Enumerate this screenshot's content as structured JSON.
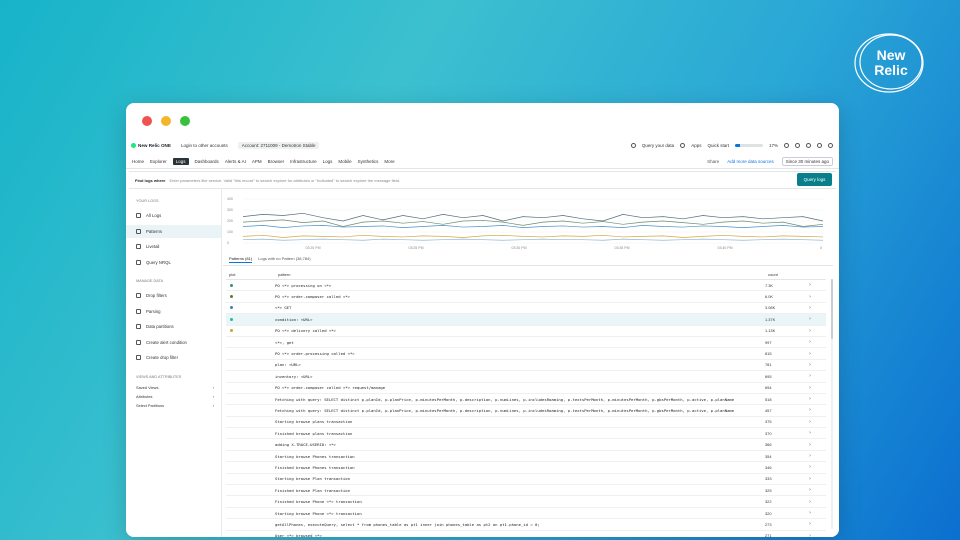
{
  "badge": {
    "line1": "New",
    "line2": "Relic"
  },
  "topbar": {
    "brand": "New Relic ONE",
    "login": "Login to other accounts",
    "account": "Account: 2711009 - Demotron Stable",
    "query_data": "Query your data",
    "apps": "Apps",
    "quick_start": "Quick start",
    "progress_pct": 17,
    "progress_label": "17%"
  },
  "nav": {
    "items": [
      "Home",
      "Explorer",
      "Logs",
      "Dashboards",
      "Alerts & AI",
      "APM",
      "Browser",
      "Infrastructure",
      "Logs",
      "Mobile",
      "Synthetics",
      "More"
    ],
    "active_index": 2,
    "share": "Share",
    "add_source": "Add more data sources",
    "time": "Since 30 minutes ago"
  },
  "querybar": {
    "label": "Find logs where",
    "placeholder": "Enter parameters like service. Valid \"this record\" to search explore for attributes or \"Indicated\" to search explore the message field.",
    "button": "Query logs"
  },
  "sidebar": {
    "sections": [
      {
        "heading": "Your logs",
        "items": [
          "All Logs",
          "Patterns",
          "Livetail",
          "Query NRQL"
        ]
      },
      {
        "heading": "Manage data",
        "items": [
          "Drop filters",
          "Parsing",
          "Data partitions",
          "Create alert condition",
          "Create drop filter"
        ]
      }
    ],
    "views_heading": "Views and attributes",
    "views": [
      "Saved Views",
      "Attributes",
      "Select Partitions"
    ],
    "active": "Patterns"
  },
  "chart_data": {
    "type": "line",
    "ylim": [
      0,
      400
    ],
    "yticks": [
      "400",
      "300",
      "200",
      "100",
      "0"
    ],
    "xticks": [
      "03:20 PM",
      "03:25 PM",
      "03:30 PM",
      "03:35 PM",
      "03:40 PM",
      "0"
    ],
    "x": [
      0,
      1,
      2,
      3,
      4,
      5,
      6,
      7,
      8,
      9,
      10,
      11,
      12,
      13,
      14,
      15,
      16,
      17,
      18,
      19,
      20,
      21,
      22,
      23,
      24,
      25,
      26,
      27,
      28,
      29
    ],
    "series": [
      {
        "color": "#4f6d7a",
        "values": [
          240,
          260,
          250,
          270,
          230,
          200,
          250,
          210,
          250,
          220,
          260,
          230,
          250,
          200,
          240,
          230,
          250,
          220,
          200,
          260,
          230,
          240,
          220,
          250,
          230,
          240,
          220,
          230,
          240,
          200
        ]
      },
      {
        "color": "#6d8a6f",
        "values": [
          190,
          200,
          210,
          185,
          200,
          150,
          190,
          200,
          180,
          195,
          170,
          200,
          205,
          190,
          160,
          190,
          200,
          180,
          195,
          170,
          190,
          200,
          185,
          170,
          190,
          200,
          180,
          190,
          150,
          170
        ]
      },
      {
        "color": "#4a90c2",
        "values": [
          150,
          160,
          140,
          155,
          160,
          145,
          150,
          155,
          140,
          150,
          160,
          145,
          150,
          160,
          140,
          150,
          155,
          145,
          150,
          140,
          160,
          150,
          145,
          155,
          150,
          140,
          150,
          160,
          145,
          150
        ]
      },
      {
        "color": "#d4a83a",
        "values": [
          60,
          70,
          50,
          65,
          60,
          55,
          70,
          60,
          55,
          65,
          60,
          50,
          65,
          70,
          60,
          55,
          65,
          60,
          70,
          55,
          60,
          65,
          50,
          60,
          70,
          60,
          55,
          65,
          60,
          55
        ]
      },
      {
        "color": "#8fb5d6",
        "values": [
          30,
          35,
          25,
          30,
          35,
          30,
          25,
          35,
          30,
          25,
          30,
          35,
          30,
          25,
          30,
          35,
          30,
          30,
          25,
          35,
          30,
          25,
          30,
          35,
          30,
          25,
          30,
          35,
          30,
          25
        ]
      }
    ]
  },
  "tabs": [
    "Patterns (81)",
    "Logs with no Pattern (38,784)"
  ],
  "table": {
    "headers": {
      "plot": "plot",
      "pattern": "pattern",
      "count": "count"
    },
    "rows": [
      {
        "color": "#3f8f6a",
        "pattern": "PO <*> processing on <*>",
        "count": "7.3K"
      },
      {
        "color": "#5a7a2a",
        "pattern": "PO <*> order-composer called <*>",
        "count": "6.0K"
      },
      {
        "color": "#3f7fb8",
        "pattern": "<*> GET",
        "count": "3.08K"
      },
      {
        "color": "#2bb5a8",
        "pattern": "condition: <URL>",
        "count": "1.37K"
      },
      {
        "color": "#d4a03a",
        "pattern": "PO <*> delivery called <*>",
        "count": "1.13K"
      },
      {
        "color": "",
        "pattern": "<*>, get",
        "count": "997"
      },
      {
        "color": "",
        "pattern": "PO <*> order-processing called <*>",
        "count": "815"
      },
      {
        "color": "",
        "pattern": "plan: <URL>",
        "count": "781"
      },
      {
        "color": "",
        "pattern": "inventory: <URL>",
        "count": "695"
      },
      {
        "color": "",
        "pattern": "PO <*> order-composer called <*> request/manage",
        "count": "694"
      },
      {
        "color": "",
        "pattern": "Fetching with query: SELECT distinct p.planId, p.planPrice, p.minutesPerMonth, p.description, p.numLines, p.includesRoaming, p.textsPerMonth, p.minutesPerMonth, p.gbsPerMonth, p.active, p.planName",
        "count": "518"
      },
      {
        "color": "",
        "pattern": "Fetching with query: SELECT distinct p.planId, p.planPrice, p.minutesPerMonth, p.description, p.numLines, p.includesRoaming, p.textsPerMonth, p.minutesPerMonth, p.gbsPerMonth, p.active, p.planName",
        "count": "457"
      },
      {
        "color": "",
        "pattern": "Starting browse plans transaction",
        "count": "375"
      },
      {
        "color": "",
        "pattern": "Finished browse plans transaction",
        "count": "370"
      },
      {
        "color": "",
        "pattern": "adding X-TRACE-USERID: <*>",
        "count": "366"
      },
      {
        "color": "",
        "pattern": "Starting browse Phones transaction",
        "count": "354"
      },
      {
        "color": "",
        "pattern": "Finished browse Phones transaction",
        "count": "346"
      },
      {
        "color": "",
        "pattern": "Starting browse Plan transaction",
        "count": "333"
      },
      {
        "color": "",
        "pattern": "Finished browse Plan transaction",
        "count": "325"
      },
      {
        "color": "",
        "pattern": "Finished browse Phone <*> transaction",
        "count": "322"
      },
      {
        "color": "",
        "pattern": "Starting browse Phone <*> transaction",
        "count": "320"
      },
      {
        "color": "",
        "pattern": "getAllPhones, executeQuery, select * from phones_table as pt1 inner join phones_table as pt2 on pt1.phone_id = 0;",
        "count": "273"
      },
      {
        "color": "",
        "pattern": "User <*> browsed <*>",
        "count": "271"
      }
    ],
    "highlight_index": 3
  }
}
